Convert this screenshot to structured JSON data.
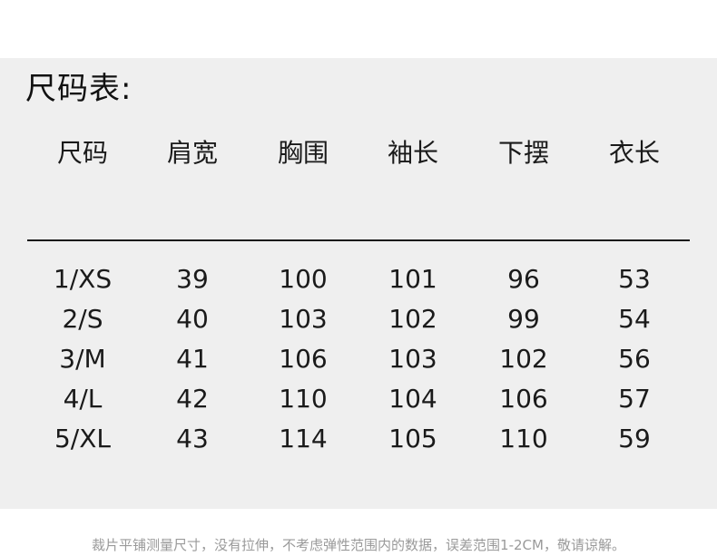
{
  "title": "尺码表:",
  "table": {
    "headers": [
      "尺码",
      "肩宽",
      "胸围",
      "袖长",
      "下摆",
      "衣长"
    ],
    "rows": [
      [
        "1/XS",
        "39",
        "100",
        "101",
        "96",
        "53"
      ],
      [
        "2/S",
        "40",
        "103",
        "102",
        "99",
        "54"
      ],
      [
        "3/M",
        "41",
        "106",
        "103",
        "102",
        "56"
      ],
      [
        "4/L",
        "42",
        "110",
        "104",
        "106",
        "57"
      ],
      [
        "5/XL",
        "43",
        "114",
        "105",
        "110",
        "59"
      ]
    ]
  },
  "footnote": "裁片平铺测量尺寸，没有拉伸，不考虑弹性范围内的数据，误差范围1-2CM，敬请谅解。",
  "colors": {
    "panel_background": "#efefef",
    "text": "#1a1a1a",
    "footnote_text": "#9a9a9a"
  }
}
